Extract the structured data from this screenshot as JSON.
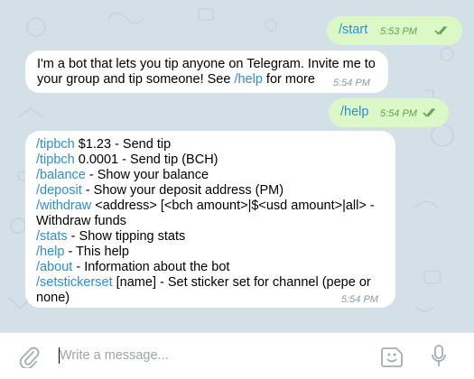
{
  "messages": [
    {
      "direction": "out",
      "text": "/start",
      "time": "5:53 PM",
      "read_icon": "double-check-icon"
    },
    {
      "direction": "in",
      "lines": [
        [
          {
            "t": "I'm a bot that lets you tip anyone on Telegram. Invite me to"
          }
        ],
        [
          {
            "t": "your group and tip someone! See "
          },
          {
            "t": "/help",
            "cmd": true
          },
          {
            "t": " for more"
          }
        ]
      ],
      "time": "5:54 PM"
    },
    {
      "direction": "out",
      "text": "/help",
      "time": "5:54 PM",
      "read_icon": "double-check-icon"
    },
    {
      "direction": "in",
      "lines": [
        [
          {
            "t": "/tipbch",
            "cmd": true
          },
          {
            "t": " $1.23 - Send tip"
          }
        ],
        [
          {
            "t": "/tipbch",
            "cmd": true
          },
          {
            "t": " 0.0001 - Send tip (BCH)"
          }
        ],
        [
          {
            "t": "/balance",
            "cmd": true
          },
          {
            "t": " - Show your balance"
          }
        ],
        [
          {
            "t": "/deposit",
            "cmd": true
          },
          {
            "t": " - Show your deposit address (PM)"
          }
        ],
        [
          {
            "t": "/withdraw",
            "cmd": true
          },
          {
            "t": " <address> [<bch amount>|$<usd amount>|all> -"
          }
        ],
        [
          {
            "t": "Withdraw funds"
          }
        ],
        [
          {
            "t": "/stats",
            "cmd": true
          },
          {
            "t": " - Show tipping stats"
          }
        ],
        [
          {
            "t": "/help",
            "cmd": true
          },
          {
            "t": " - This help"
          }
        ],
        [
          {
            "t": "/about",
            "cmd": true
          },
          {
            "t": " - Information about the bot"
          }
        ],
        [
          {
            "t": "/setstickerset",
            "cmd": true
          },
          {
            "t": " [name] - Set sticker set for channel (pepe or"
          }
        ],
        [
          {
            "t": "none)"
          }
        ]
      ],
      "time": "5:54 PM"
    }
  ],
  "composer": {
    "placeholder": "Write a message...",
    "attach_icon": "paperclip-icon",
    "emoji_icon": "sticker-emoji-icon",
    "mic_icon": "microphone-icon"
  },
  "colors": {
    "chat_background": "#d3e0e8",
    "outgoing_bubble": "#dcf8c6",
    "incoming_bubble": "#ffffff",
    "command_link": "#2d8dd7",
    "outgoing_time": "#5da653",
    "incoming_time": "#8c9aa4"
  }
}
